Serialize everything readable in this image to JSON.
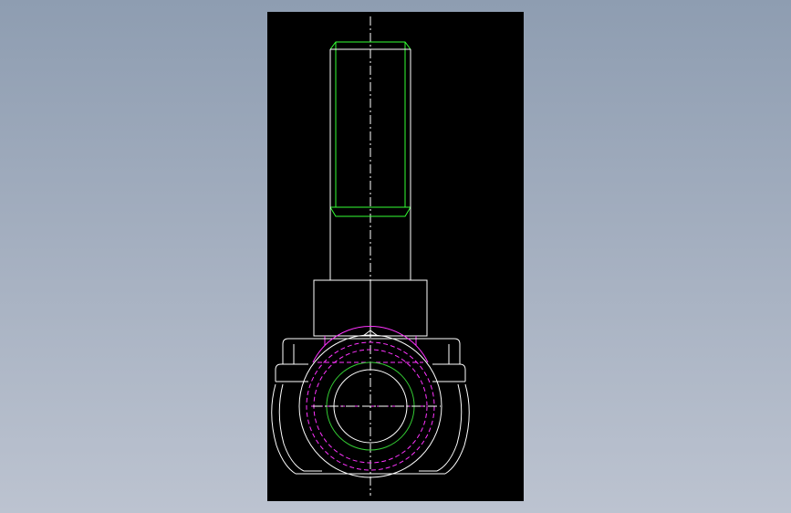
{
  "viewport": {
    "background": "#000000"
  },
  "drawing": {
    "line_colors": {
      "outline": "#ffffff",
      "thread": "#33ff33",
      "hidden": "#ff33ff",
      "centerline": "#ffffff",
      "bore": "#33cc33"
    }
  }
}
